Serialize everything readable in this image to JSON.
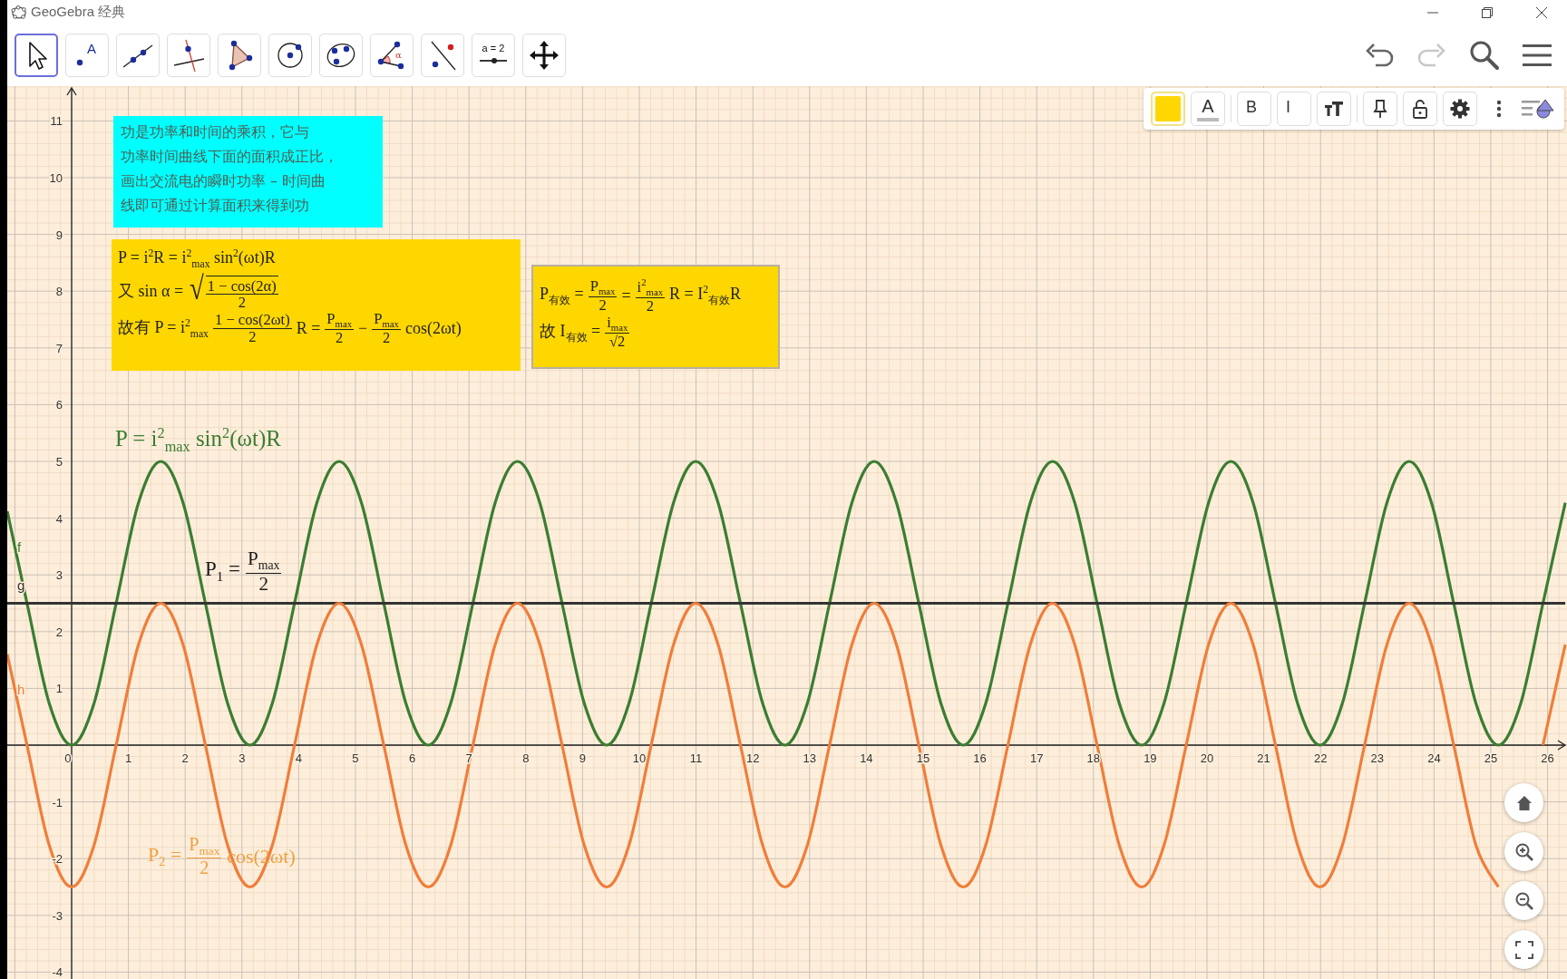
{
  "window": {
    "title": "GeoGebra 经典"
  },
  "toolbar": {
    "tools": [
      {
        "kind": "move",
        "selected": true
      },
      {
        "kind": "point",
        "selected": false,
        "label": "A"
      },
      {
        "kind": "line",
        "selected": false
      },
      {
        "kind": "perpendicular",
        "selected": false
      },
      {
        "kind": "polygon",
        "selected": false
      },
      {
        "kind": "circle",
        "selected": false
      },
      {
        "kind": "circle3",
        "selected": false
      },
      {
        "kind": "angle",
        "selected": false,
        "label": "α"
      },
      {
        "kind": "reflect",
        "selected": false
      },
      {
        "kind": "slider",
        "selected": false,
        "label": "a = 2"
      },
      {
        "kind": "pan",
        "selected": false
      }
    ],
    "actions": [
      {
        "kind": "undo",
        "disabled": false
      },
      {
        "kind": "redo",
        "disabled": true
      },
      {
        "kind": "search"
      },
      {
        "kind": "menu"
      }
    ]
  },
  "style_bar": {
    "items": [
      {
        "kind": "color",
        "color": "#ffd700"
      },
      {
        "kind": "text_color",
        "label": "A"
      },
      {
        "kind": "bold",
        "label": "B",
        "on": false
      },
      {
        "kind": "italic",
        "label": "I",
        "on": false
      },
      {
        "kind": "text_size"
      },
      {
        "kind": "pin"
      },
      {
        "kind": "lock"
      },
      {
        "kind": "settings"
      },
      {
        "kind": "more"
      },
      {
        "kind": "view"
      }
    ]
  },
  "graphics": {
    "text_boxes": [
      {
        "kind": "note",
        "color": "#00ffff",
        "lines": [
          "功是功率和时间的乘积，它与",
          "功率时间曲线下面的面积成正比，",
          "画出交流电的瞬时功率 – 时间曲",
          "线即可通过计算面积来得到功"
        ]
      },
      {
        "kind": "formula",
        "color": "#ffd700",
        "lines": [
          [
            {
              "kind": "text",
              "text": "P = i$^{2}$R = i$^{2}$$_{max}$ sin$^{2}$(ωt)R"
            }
          ],
          [
            {
              "kind": "text",
              "text": "又 sin α = "
            },
            {
              "kind": "sqrt",
              "sign": "√",
              "num": "1 − cos(2α)",
              "den": "2"
            }
          ],
          [
            {
              "kind": "text",
              "text": "故有 P = i$^{2}$$_{max}$"
            },
            {
              "kind": "frac",
              "num": "1 − cos(2ωt)",
              "den": "2"
            },
            {
              "kind": "text",
              "text": "R ="
            },
            {
              "kind": "frac",
              "num": "P$_{max}$",
              "den": "2"
            },
            {
              "kind": "text",
              "text": "−"
            },
            {
              "kind": "frac",
              "num": "P$_{max}$",
              "den": "2"
            },
            {
              "kind": "text",
              "text": "cos(2ωt)"
            }
          ]
        ]
      },
      {
        "kind": "framed_formula",
        "color": "#ffd700",
        "lines": [
          [
            {
              "kind": "text",
              "text": "P$_{有效}$ ="
            },
            {
              "kind": "frac",
              "num": "P$_{max}$",
              "den": "2"
            },
            {
              "kind": "text",
              "text": "="
            },
            {
              "kind": "frac",
              "num": "i$^{2}$$_{max}$",
              "den": "2"
            },
            {
              "kind": "text",
              "text": "R = I$^{2}$$_{有效}$R"
            }
          ],
          [
            {
              "kind": "text",
              "text": "故 I$_{有效}$ ="
            },
            {
              "kind": "frac",
              "num": "i$_{max}$",
              "den": "√2"
            }
          ]
        ]
      }
    ],
    "captions": [
      {
        "color": "#3b7d31",
        "parts": [
          {
            "kind": "text",
            "text": "P = i$^{2}$$_{max}$ sin$^{2}$(ωt)R"
          }
        ]
      },
      {
        "color": "#1a1a1a",
        "parts": [
          {
            "kind": "text",
            "text": "P$_{1}$ ="
          },
          {
            "kind": "frac",
            "num": "P$_{max}$",
            "den": "2"
          }
        ]
      },
      {
        "color": "#f0a040",
        "parts": [
          {
            "kind": "text",
            "text": "P$_{2}$ ="
          },
          {
            "kind": "frac",
            "num": "P$_{max}$",
            "den": "2"
          },
          {
            "kind": "text",
            "text": "cos(2ωt)"
          }
        ]
      }
    ],
    "chart_data": {
      "type": "line",
      "xlim": [
        -1.134,
        26.342
      ],
      "ylim": [
        -4.121,
        11.613
      ],
      "grid": true,
      "xticks": [
        0,
        1,
        2,
        3,
        4,
        5,
        6,
        7,
        8,
        9,
        10,
        11,
        12,
        13,
        14,
        15,
        16,
        17,
        18,
        19,
        20,
        21,
        22,
        23,
        24,
        25,
        26
      ],
      "yticks": [
        -4,
        -3,
        -2,
        -1,
        1,
        2,
        3,
        4,
        5,
        6,
        7,
        8,
        9,
        10,
        11
      ],
      "x": [
        -1.134,
        -0.785,
        -0.393,
        0,
        0.393,
        0.785,
        1.178,
        1.571,
        1.963,
        2.356,
        2.749,
        3.142,
        3.534,
        3.927,
        4.32,
        4.712,
        5.105,
        5.498,
        5.89,
        6.283,
        6.676,
        7.069,
        7.461,
        7.854,
        8.247,
        8.639,
        9.032,
        9.425,
        9.817,
        10.21,
        10.603,
        10.996,
        11.388,
        11.781,
        12.174,
        12.566,
        12.959,
        13.352,
        13.744,
        14.137,
        14.53,
        14.923,
        15.315,
        15.708,
        16.101,
        16.493,
        16.886,
        17.279,
        17.671,
        18.064,
        18.457,
        18.85,
        19.242,
        19.635,
        20.028,
        20.42,
        20.813,
        21.206,
        21.598,
        21.991,
        22.384,
        22.777,
        23.169,
        23.562,
        23.955,
        24.347,
        24.74,
        25.133,
        25.525,
        25.918,
        26.311
      ],
      "series": [
        {
          "name": "f",
          "color": "#3b7d31",
          "values": [
            4.12,
            2.5,
            0.73,
            0,
            0.73,
            2.5,
            4.27,
            5,
            4.27,
            2.5,
            0.73,
            0,
            0.73,
            2.5,
            4.27,
            5,
            4.27,
            2.5,
            0.73,
            0,
            0.73,
            2.5,
            4.27,
            5,
            4.27,
            2.5,
            0.73,
            0,
            0.73,
            2.5,
            4.27,
            5,
            4.27,
            2.5,
            0.73,
            0,
            0.73,
            2.5,
            4.27,
            5,
            4.27,
            2.5,
            0.73,
            0,
            0.73,
            2.5,
            4.27,
            5,
            4.27,
            2.5,
            0.73,
            0,
            0.73,
            2.5,
            4.27,
            5,
            4.27,
            2.5,
            0.73,
            0,
            0.73,
            2.5,
            4.27,
            5,
            4.27,
            2.5,
            0.73,
            0,
            0.73,
            2.5,
            4.27
          ]
        },
        {
          "name": "g",
          "color": "#333333",
          "values": [
            2.5,
            2.5,
            2.5,
            2.5,
            2.5,
            2.5,
            2.5,
            2.5,
            2.5,
            2.5,
            2.5,
            2.5,
            2.5,
            2.5,
            2.5,
            2.5,
            2.5,
            2.5,
            2.5,
            2.5,
            2.5,
            2.5,
            2.5,
            2.5,
            2.5,
            2.5,
            2.5,
            2.5,
            2.5,
            2.5,
            2.5,
            2.5,
            2.5,
            2.5,
            2.5,
            2.5,
            2.5,
            2.5,
            2.5,
            2.5,
            2.5,
            2.5,
            2.5,
            2.5,
            2.5,
            2.5,
            2.5,
            2.5,
            2.5,
            2.5,
            2.5,
            2.5,
            2.5,
            2.5,
            2.5,
            2.5,
            2.5,
            2.5,
            2.5,
            2.5,
            2.5,
            2.5,
            2.5,
            2.5,
            2.5,
            2.5,
            2.5,
            2.5,
            2.5,
            2.5,
            2.5
          ]
        },
        {
          "name": "h",
          "color": "#f07d3a",
          "values": [
            1.6,
            0,
            -1.77,
            -2.5,
            -1.77,
            0,
            1.77,
            2.5,
            1.77,
            0,
            -1.77,
            -2.5,
            -1.77,
            0,
            1.77,
            2.5,
            1.77,
            0,
            -1.77,
            -2.5,
            -1.77,
            0,
            1.77,
            2.5,
            1.77,
            0,
            -1.77,
            -2.5,
            -1.77,
            0,
            1.77,
            2.5,
            1.77,
            0,
            -1.77,
            -2.5,
            -1.77,
            0,
            1.77,
            2.5,
            1.77,
            0,
            -1.77,
            -2.5,
            -1.77,
            0,
            1.77,
            2.5,
            1.77,
            0,
            -1.77,
            -2.5,
            -1.77,
            0,
            1.77,
            2.5,
            1.77,
            0,
            -1.77,
            -2.5,
            -1.77,
            0,
            1.77,
            2.5,
            1.77,
            0,
            -1.77,
            -2.5,
            null,
            0,
            1.77
          ]
        }
      ]
    }
  },
  "view_controls": [
    {
      "kind": "home"
    },
    {
      "kind": "zoom_in"
    },
    {
      "kind": "zoom_out"
    },
    {
      "kind": "fullscreen"
    }
  ]
}
